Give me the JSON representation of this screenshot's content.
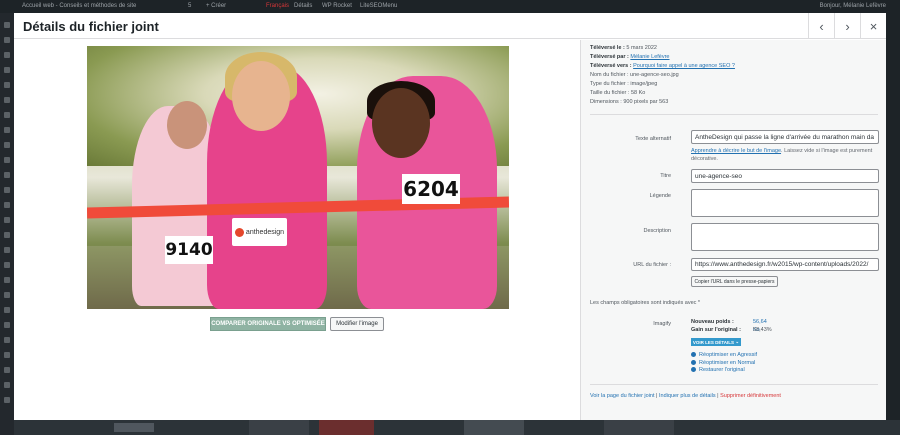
{
  "adminbar": {
    "site": "Accueil web - Conseils et méthodes de site",
    "count": "5",
    "new": "+ Créer",
    "lang": "Français",
    "details": "Détails",
    "wp": "WP Rocket",
    "lm": "LiteSEOMenu",
    "user": "Bonjour, Mélanie Lefèvre"
  },
  "modal": {
    "title": "Détails du fichier joint",
    "prev_icon": "‹",
    "next_icon": "›",
    "close_icon": "×"
  },
  "photo": {
    "bib1": "9140",
    "bib2": "6204",
    "logo": "anthedesign"
  },
  "buttons": {
    "compare": "COMPARER ORIGINALE VS OPTIMISÉE",
    "edit": "Modifier l'image"
  },
  "info": {
    "uploaded_on_label": "Téléversé le :",
    "uploaded_on": "5 mars 2022",
    "uploaded_by_label": "Téléversé par :",
    "uploaded_by": "Mélanie Lefèvre",
    "uploaded_to_label": "Téléversé vers :",
    "uploaded_to": "Pourquoi faire appel à une agence SEO&nbsp;?",
    "filename_label": "Nom du fichier :",
    "filename": "une-agence-seo.jpg",
    "filetype_label": "Type du fichier :",
    "filetype": "image/jpeg",
    "filesize_label": "Taille du fichier :",
    "filesize": "58 Ko",
    "dims_label": "Dimensions :",
    "dims": "900 pixels par 563"
  },
  "fields": {
    "alt_label": "Texte alternatif",
    "alt_value": "AntheDesign qui passe la ligne d'arrivée du marathon main da",
    "alt_help_link": "Apprendre à décrire le but de l'image",
    "alt_help_text": ". Laissez vide si l'image est purement décorative.",
    "title_label": "Titre",
    "title_value": "une-agence-seo",
    "caption_label": "Légende",
    "caption_value": "",
    "desc_label": "Description",
    "desc_value": "",
    "url_label": "URL du fichier :",
    "url_value": "https://www.anthedesign.fr/w2015/wp-content/uploads/2022/",
    "copy_button": "Copier l'URL dans le presse-papiers"
  },
  "required_note": "Les champs obligatoires sont indiqués avec *",
  "imagify": {
    "label": "Imagify",
    "new_weight_label": "Nouveau poids :",
    "new_weight": "56,64 Ko",
    "gain_label": "Gain sur l'original :",
    "gain": "58,43%",
    "details_button": "VOIR LES DÉTAILS",
    "option1": "Réoptimiser en Agressif",
    "option2": "Réoptimiser en Normal",
    "option3": "Restaurer l'original"
  },
  "footer_links": {
    "view": "Voir la page du fichier joint",
    "more": "Indiquer plus de détails",
    "delete": "Supprimer définitivement"
  }
}
